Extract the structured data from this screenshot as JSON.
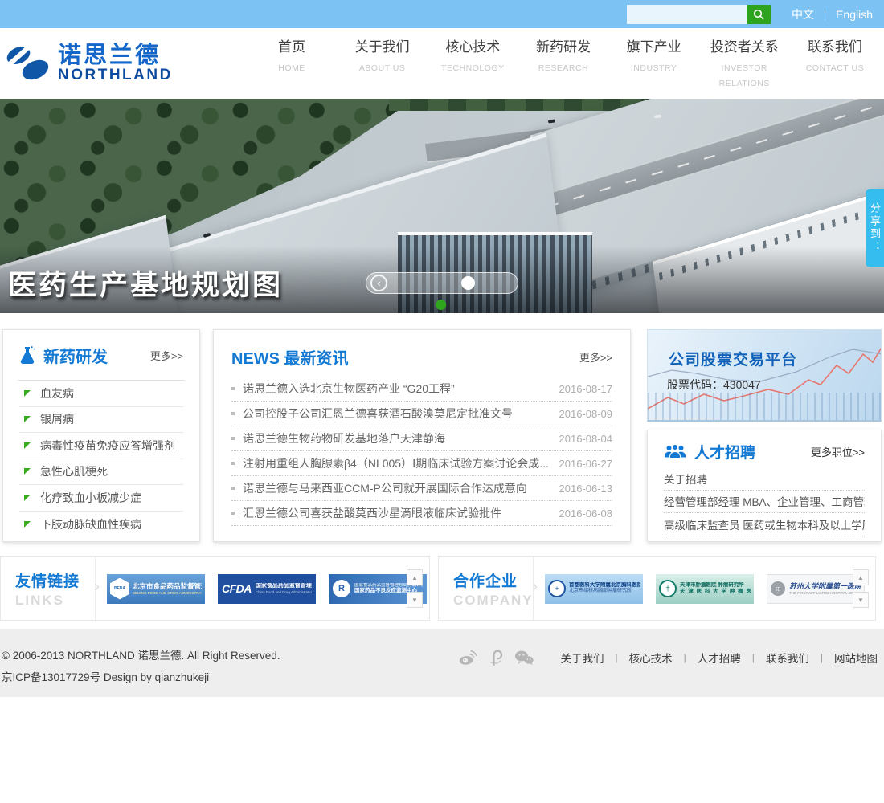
{
  "colors": {
    "topbar": "#7cc2f2",
    "accent_blue": "#1379d3",
    "search_green": "#2ea31d",
    "share_blue": "#35bdf0",
    "slider_active_green": "#2fa51d",
    "footer_bg": "#eeeeee"
  },
  "icons": {
    "search": "magnifier-icon",
    "research": "flask-icon",
    "recruit": "people-group-icon",
    "slider_prev": "chevron-left-icon",
    "scroll_up": "arrow-up-icon",
    "scroll_down": "arrow-down-icon",
    "socials": [
      "weibo-icon",
      "tencent-weibo-icon",
      "wechat-icon"
    ]
  },
  "topbar": {
    "search_value": "",
    "lang_cn": "中文",
    "divider": "|",
    "lang_en": "English"
  },
  "logo": {
    "cn": "诺思兰德",
    "en": "NORTHLAND"
  },
  "nav": {
    "items": [
      {
        "cn": "首页",
        "en": "HOME"
      },
      {
        "cn": "关于我们",
        "en": "ABOUT US"
      },
      {
        "cn": "核心技术",
        "en": "TECHNOLOGY"
      },
      {
        "cn": "新药研发",
        "en": "RESEARCH"
      },
      {
        "cn": "旗下产业",
        "en": "INDUSTRY"
      },
      {
        "cn": "投资者关系",
        "en": "INVESTOR RELATIONS"
      },
      {
        "cn": "联系我们",
        "en": "CONTACT US"
      }
    ]
  },
  "hero": {
    "caption": "医药生产基地规划图",
    "share_label": "分享到：",
    "prev_glyph": "‹"
  },
  "research": {
    "title": "新药研发",
    "more": "更多>>",
    "items": [
      "血友病",
      "银屑病",
      "病毒性疫苗免疫应答增强剂",
      "急性心肌梗死",
      "化疗致血小板减少症",
      "下肢动脉缺血性疾病"
    ]
  },
  "news": {
    "title": "NEWS 最新资讯",
    "more": "更多>>",
    "items": [
      {
        "title": "诺思兰德入选北京生物医药产业 “G20工程”",
        "date": "2016-08-17"
      },
      {
        "title": "公司控股子公司汇恩兰德喜获酒石酸溴莫尼定批准文号",
        "date": "2016-08-09"
      },
      {
        "title": "诺思兰德生物药物研发基地落户天津静海",
        "date": "2016-08-04"
      },
      {
        "title": "注射用重组人胸腺素β4（NL005）Ⅰ期临床试验方案讨论会成...",
        "date": "2016-06-27"
      },
      {
        "title": "诺思兰德与马来西亚CCM-P公司就开展国际合作达成意向",
        "date": "2016-06-13"
      },
      {
        "title": "汇恩兰德公司喜获盐酸莫西沙星滴眼液临床试验批件",
        "date": "2016-06-08"
      }
    ]
  },
  "stock": {
    "title": "公司股票交易平台",
    "code": "股票代码：430047"
  },
  "recruit": {
    "title": "人才招聘",
    "more": "更多职位>>",
    "items": [
      "关于招聘",
      "经营管理部经理  MBA、企业管理、工商管理...",
      "高级临床监查员  医药或生物本科及以上学历"
    ]
  },
  "links": {
    "title_cn": "友情链接",
    "title_en": "LINKS",
    "logos": [
      {
        "badge": "BFDA",
        "line1": "北京市食品药品监督管理局",
        "line2": "BEIJING FOOD AND DRUG ADMINISTRATION"
      },
      {
        "badge": "CFDA",
        "line1": "国家食品药品监督管理总局",
        "line2": "China Food and Drug Administration"
      },
      {
        "badge": "R",
        "line1": "国家食品药品监督管理总局药品评价中心",
        "line2": "国家药品不良反应监测中心"
      }
    ]
  },
  "company": {
    "title_cn": "合作企业",
    "title_en": "COMPANY",
    "logos": [
      {
        "badge": "+",
        "line1": "首都医科大学附属北京胸科医院",
        "line2": "北京市结核病胸部肿瘤研究所"
      },
      {
        "badge": "†",
        "line1": "天津市肿瘤医院  肿瘤研究所",
        "line2": "天 津 医 科 大 学 肿 瘤 医 院"
      },
      {
        "badge": "印",
        "line1": "苏州大学附属第一医院",
        "line2": "THE FIRST AFFILIATED HOSPITAL OF SOOCHOW UNIVERSITY"
      }
    ]
  },
  "footer": {
    "copyright": "© 2006-2013 NORTHLAND 诺思兰德. All Right Reserved.",
    "icp": "京ICP备13017729号 Design by qianzhukeji",
    "divider": "|",
    "links": [
      "关于我们",
      "核心技术",
      "人才招聘",
      "联系我们",
      "网站地图"
    ]
  }
}
